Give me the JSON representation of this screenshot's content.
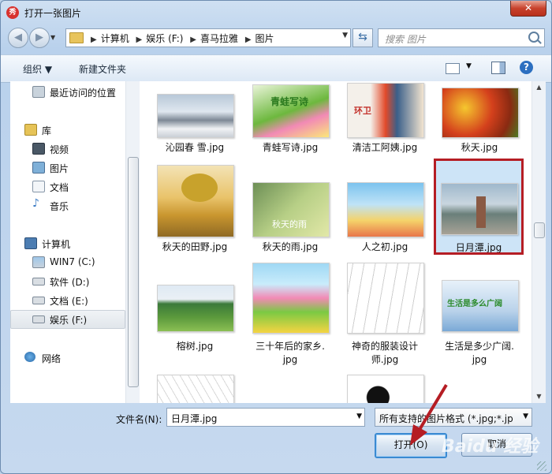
{
  "window": {
    "title": "打开一张图片",
    "app_icon_text": "秀"
  },
  "nav": {
    "back_icon": "back-arrow-icon",
    "forward_icon": "forward-arrow-icon",
    "breadcrumbs": [
      "计算机",
      "娱乐 (F:)",
      "喜马拉雅",
      "图片"
    ],
    "search_placeholder": "搜索 图片"
  },
  "toolbar": {
    "organize_label": "组织 ▼",
    "new_folder_label": "新建文件夹"
  },
  "sidebar": {
    "items": [
      {
        "label": "最近访问的位置",
        "icon": "recent-places-icon"
      },
      {
        "label": "库",
        "icon": "library-icon"
      },
      {
        "label": "视频",
        "icon": "video-icon"
      },
      {
        "label": "图片",
        "icon": "pictures-icon"
      },
      {
        "label": "文档",
        "icon": "documents-icon"
      },
      {
        "label": "音乐",
        "icon": "music-icon"
      },
      {
        "label": "计算机",
        "icon": "computer-icon"
      },
      {
        "label": "WIN7 (C:)",
        "icon": "system-drive-icon"
      },
      {
        "label": "软件 (D:)",
        "icon": "drive-icon"
      },
      {
        "label": "文档 (E:)",
        "icon": "drive-icon"
      },
      {
        "label": "娱乐 (F:)",
        "icon": "drive-icon"
      },
      {
        "label": "网络",
        "icon": "network-icon"
      }
    ]
  },
  "files": [
    {
      "name": "沁园春 雪.jpg"
    },
    {
      "name": "青蛙写诗.jpg",
      "thumb_text": "青蛙写诗"
    },
    {
      "name": "清洁工阿姨.jpg",
      "thumb_text": "环卫"
    },
    {
      "name": "秋天.jpg"
    },
    {
      "name": "秋天的田野.jpg"
    },
    {
      "name": "秋天的雨.jpg",
      "thumb_text": "秋天的雨"
    },
    {
      "name": "人之初.jpg"
    },
    {
      "name": "日月潭.jpg"
    },
    {
      "name": "榕树.jpg"
    },
    {
      "name_line1": "三十年后的家乡.",
      "name_line2": "jpg"
    },
    {
      "name_line1": "神奇的服装设计",
      "name_line2": "师.jpg"
    },
    {
      "name_line1": "生活是多少广阔.",
      "name_line2": "jpg",
      "thumb_text": "生活是多么广阔"
    }
  ],
  "bottom": {
    "filename_label": "文件名(N):",
    "filename_value": "日月潭.jpg",
    "filetype_value": "所有支持的图片格式 (*.jpg;*.jp",
    "open_label": "打开(O)",
    "cancel_label": "取消"
  },
  "watermark": "Baidu 经验",
  "colors": {
    "highlight": "#b51d24",
    "selection": "#cde4f7",
    "accent": "#3a8ad2"
  }
}
